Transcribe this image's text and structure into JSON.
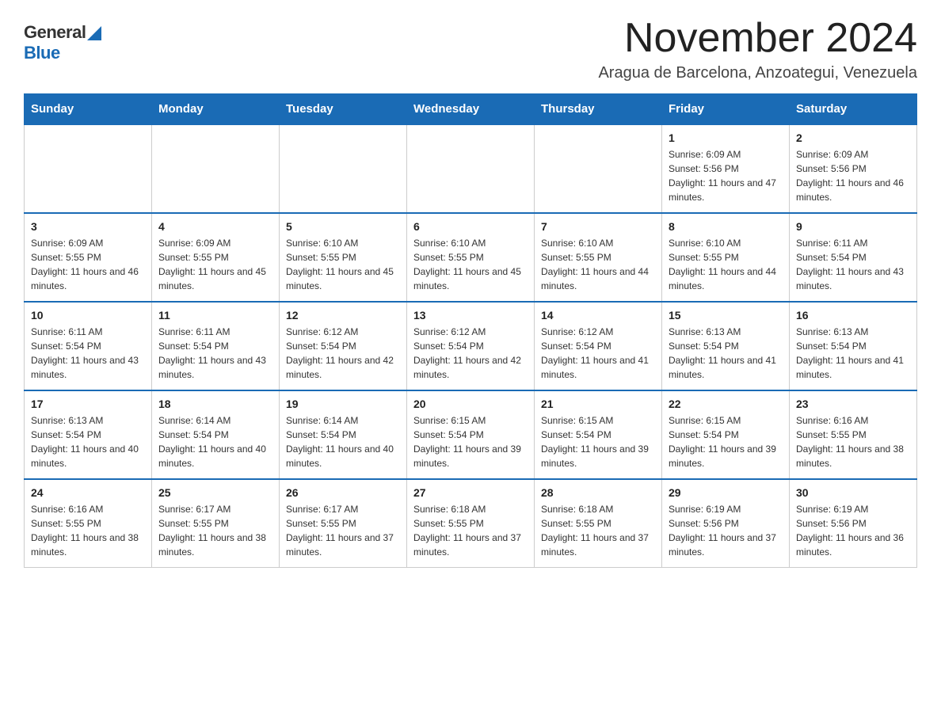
{
  "logo": {
    "general": "General",
    "blue": "Blue"
  },
  "header": {
    "month": "November 2024",
    "location": "Aragua de Barcelona, Anzoategui, Venezuela"
  },
  "weekdays": [
    "Sunday",
    "Monday",
    "Tuesday",
    "Wednesday",
    "Thursday",
    "Friday",
    "Saturday"
  ],
  "weeks": [
    [
      {
        "day": "",
        "info": ""
      },
      {
        "day": "",
        "info": ""
      },
      {
        "day": "",
        "info": ""
      },
      {
        "day": "",
        "info": ""
      },
      {
        "day": "",
        "info": ""
      },
      {
        "day": "1",
        "info": "Sunrise: 6:09 AM\nSunset: 5:56 PM\nDaylight: 11 hours and 47 minutes."
      },
      {
        "day": "2",
        "info": "Sunrise: 6:09 AM\nSunset: 5:56 PM\nDaylight: 11 hours and 46 minutes."
      }
    ],
    [
      {
        "day": "3",
        "info": "Sunrise: 6:09 AM\nSunset: 5:55 PM\nDaylight: 11 hours and 46 minutes."
      },
      {
        "day": "4",
        "info": "Sunrise: 6:09 AM\nSunset: 5:55 PM\nDaylight: 11 hours and 45 minutes."
      },
      {
        "day": "5",
        "info": "Sunrise: 6:10 AM\nSunset: 5:55 PM\nDaylight: 11 hours and 45 minutes."
      },
      {
        "day": "6",
        "info": "Sunrise: 6:10 AM\nSunset: 5:55 PM\nDaylight: 11 hours and 45 minutes."
      },
      {
        "day": "7",
        "info": "Sunrise: 6:10 AM\nSunset: 5:55 PM\nDaylight: 11 hours and 44 minutes."
      },
      {
        "day": "8",
        "info": "Sunrise: 6:10 AM\nSunset: 5:55 PM\nDaylight: 11 hours and 44 minutes."
      },
      {
        "day": "9",
        "info": "Sunrise: 6:11 AM\nSunset: 5:54 PM\nDaylight: 11 hours and 43 minutes."
      }
    ],
    [
      {
        "day": "10",
        "info": "Sunrise: 6:11 AM\nSunset: 5:54 PM\nDaylight: 11 hours and 43 minutes."
      },
      {
        "day": "11",
        "info": "Sunrise: 6:11 AM\nSunset: 5:54 PM\nDaylight: 11 hours and 43 minutes."
      },
      {
        "day": "12",
        "info": "Sunrise: 6:12 AM\nSunset: 5:54 PM\nDaylight: 11 hours and 42 minutes."
      },
      {
        "day": "13",
        "info": "Sunrise: 6:12 AM\nSunset: 5:54 PM\nDaylight: 11 hours and 42 minutes."
      },
      {
        "day": "14",
        "info": "Sunrise: 6:12 AM\nSunset: 5:54 PM\nDaylight: 11 hours and 41 minutes."
      },
      {
        "day": "15",
        "info": "Sunrise: 6:13 AM\nSunset: 5:54 PM\nDaylight: 11 hours and 41 minutes."
      },
      {
        "day": "16",
        "info": "Sunrise: 6:13 AM\nSunset: 5:54 PM\nDaylight: 11 hours and 41 minutes."
      }
    ],
    [
      {
        "day": "17",
        "info": "Sunrise: 6:13 AM\nSunset: 5:54 PM\nDaylight: 11 hours and 40 minutes."
      },
      {
        "day": "18",
        "info": "Sunrise: 6:14 AM\nSunset: 5:54 PM\nDaylight: 11 hours and 40 minutes."
      },
      {
        "day": "19",
        "info": "Sunrise: 6:14 AM\nSunset: 5:54 PM\nDaylight: 11 hours and 40 minutes."
      },
      {
        "day": "20",
        "info": "Sunrise: 6:15 AM\nSunset: 5:54 PM\nDaylight: 11 hours and 39 minutes."
      },
      {
        "day": "21",
        "info": "Sunrise: 6:15 AM\nSunset: 5:54 PM\nDaylight: 11 hours and 39 minutes."
      },
      {
        "day": "22",
        "info": "Sunrise: 6:15 AM\nSunset: 5:54 PM\nDaylight: 11 hours and 39 minutes."
      },
      {
        "day": "23",
        "info": "Sunrise: 6:16 AM\nSunset: 5:55 PM\nDaylight: 11 hours and 38 minutes."
      }
    ],
    [
      {
        "day": "24",
        "info": "Sunrise: 6:16 AM\nSunset: 5:55 PM\nDaylight: 11 hours and 38 minutes."
      },
      {
        "day": "25",
        "info": "Sunrise: 6:17 AM\nSunset: 5:55 PM\nDaylight: 11 hours and 38 minutes."
      },
      {
        "day": "26",
        "info": "Sunrise: 6:17 AM\nSunset: 5:55 PM\nDaylight: 11 hours and 37 minutes."
      },
      {
        "day": "27",
        "info": "Sunrise: 6:18 AM\nSunset: 5:55 PM\nDaylight: 11 hours and 37 minutes."
      },
      {
        "day": "28",
        "info": "Sunrise: 6:18 AM\nSunset: 5:55 PM\nDaylight: 11 hours and 37 minutes."
      },
      {
        "day": "29",
        "info": "Sunrise: 6:19 AM\nSunset: 5:56 PM\nDaylight: 11 hours and 37 minutes."
      },
      {
        "day": "30",
        "info": "Sunrise: 6:19 AM\nSunset: 5:56 PM\nDaylight: 11 hours and 36 minutes."
      }
    ]
  ]
}
